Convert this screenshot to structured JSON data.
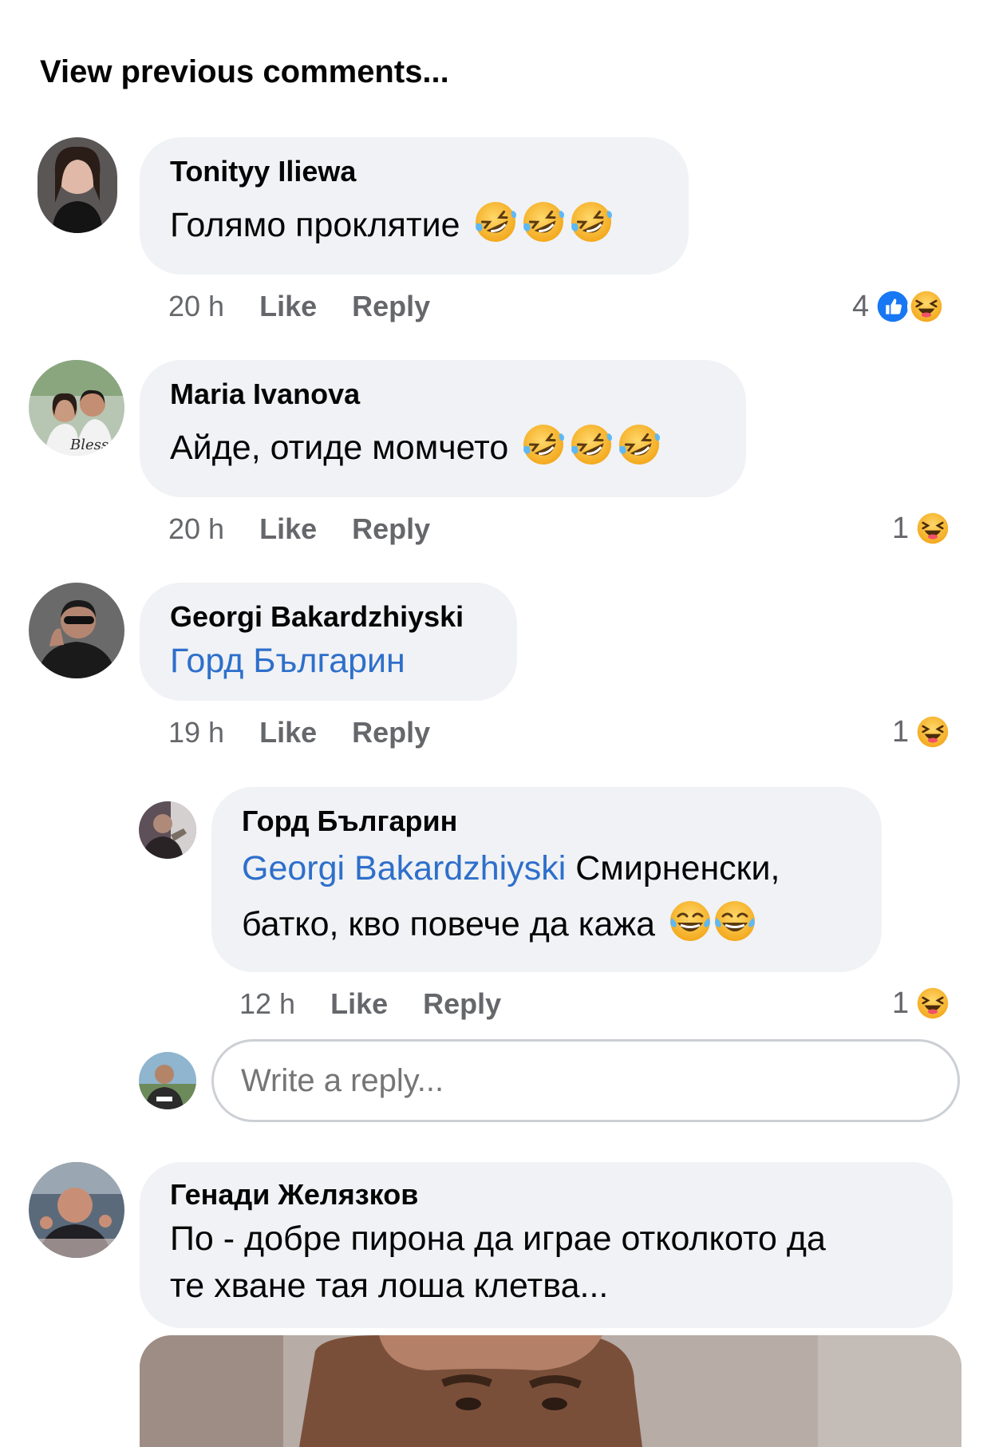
{
  "view_previous": "View previous comments...",
  "comments": [
    {
      "author": "Tonityy Iliewa",
      "text": "Голямо проклятие",
      "time": "20 h",
      "like": "Like",
      "reply": "Reply",
      "reaction_count": "4",
      "emojis": [
        "rofl-emoji",
        "rofl-emoji",
        "rofl-emoji"
      ]
    },
    {
      "author": "Maria Ivanova",
      "text": "Айде, отиде момчето",
      "time": "20 h",
      "like": "Like",
      "reply": "Reply",
      "reaction_count": "1",
      "avatar_text": "Blessed"
    },
    {
      "author": "Georgi Bakardzhiyski",
      "tag": "Горд Българин",
      "time": "19 h",
      "like": "Like",
      "reply": "Reply",
      "reaction_count": "1"
    },
    {
      "author": "Генади Желязков",
      "text_line1": "По - добре пирона да играе отколкото да",
      "text_line2": "те хване тая лоша клетва..."
    }
  ],
  "nested_reply": {
    "author": "Горд Българин",
    "tag": "Georgi Bakardzhiyski",
    "text_line1": " Смирненски,",
    "text_line2": "батко, кво повече да кажа",
    "time": "12 h",
    "like": "Like",
    "reply": "Reply",
    "reaction_count": "1"
  },
  "reply_input": {
    "placeholder": "Write a reply..."
  },
  "colors": {
    "bubble": "#f0f2f5",
    "link": "#2e6fcb",
    "meta": "#65676b",
    "like_blue": "#1877f2",
    "haha_yellow": "#f7b928"
  }
}
